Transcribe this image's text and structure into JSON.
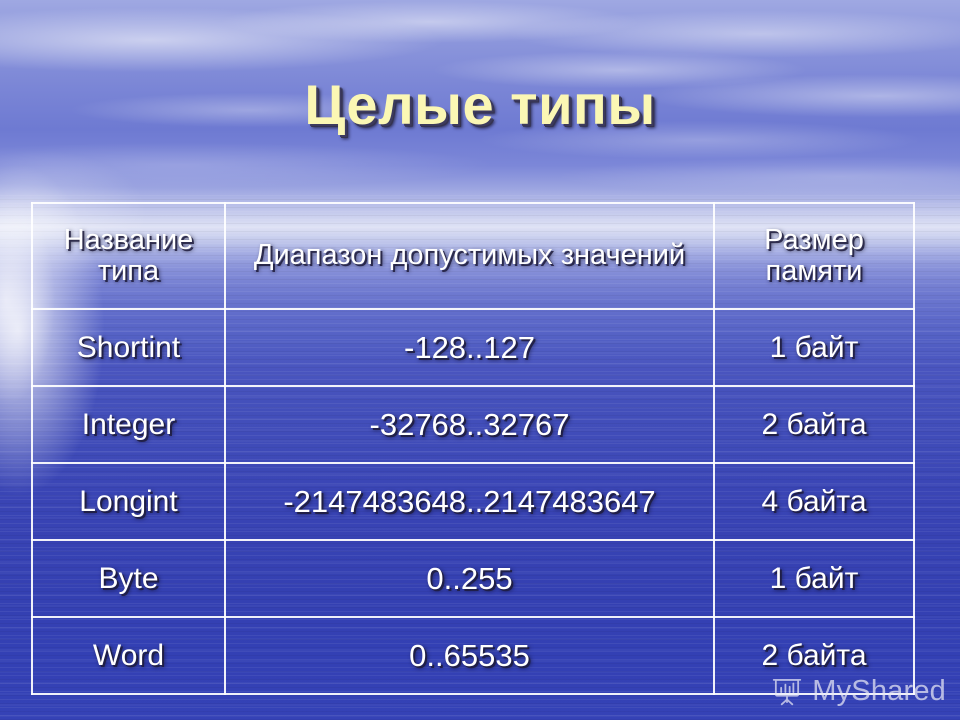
{
  "slide": {
    "title": "Целые типы",
    "title_color": "#fbf7b4",
    "background_description": "sky-over-ocean-photo",
    "background_color": "#3a36b0"
  },
  "table": {
    "headers": {
      "name": "Название типа",
      "range": "Диапазон допустимых значений",
      "size": "Размер памяти"
    },
    "rows": [
      {
        "name": "Shortint",
        "range": "-128..127",
        "size": "1 байт"
      },
      {
        "name": "Integer",
        "range": "-32768..32767",
        "size": "2 байта"
      },
      {
        "name": "Longint",
        "range": "-2147483648..2147483647",
        "size": "4 байта"
      },
      {
        "name": "Byte",
        "range": "0..255",
        "size": "1 байт"
      },
      {
        "name": "Word",
        "range": "0..65535",
        "size": "2 байта"
      }
    ]
  },
  "watermark": {
    "text": "MyShared",
    "icon": "presentation-board-icon"
  }
}
